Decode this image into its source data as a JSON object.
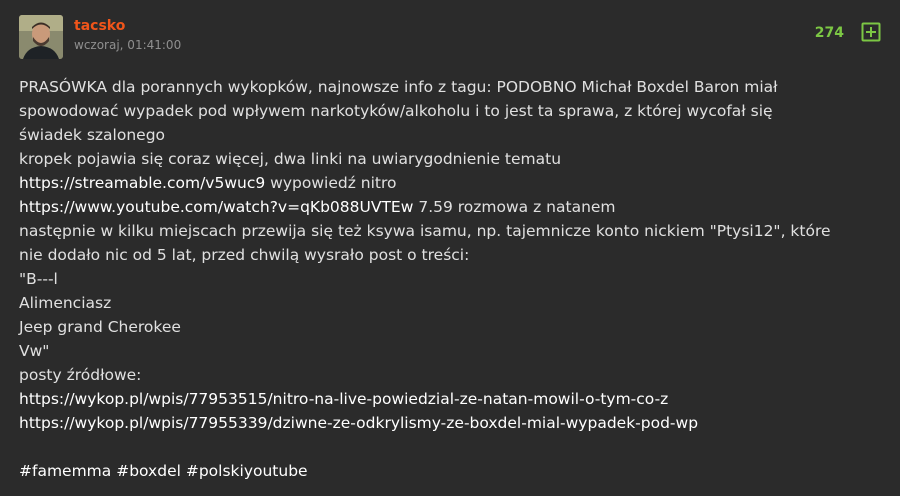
{
  "author": {
    "name": "tacsko",
    "timestamp": "wczoraj, 01:41:00"
  },
  "votes": {
    "count": "274",
    "plus_icon": "plus-square-icon"
  },
  "colors": {
    "background": "#2b2b2b",
    "author": "#f1551a",
    "votes": "#7cc744",
    "text": "#e0e0e0",
    "link": "#ffffff"
  },
  "content": {
    "line1": "PRASÓWKA dla porannych wykopków, najnowsze info z tagu: PODOBNO Michał Boxdel Baron miał",
    "line2": "spowodować wypadek pod wpływem narkotyków/alkoholu i to jest ta sprawa, z której wycofał się",
    "line3": "świadek szalonego",
    "line4": "kropek pojawia się coraz więcej, dwa linki na uwiarygodnienie tematu",
    "link1": "https://streamable.com/v5wuc9",
    "link1_suffix": " wypowiedź nitro",
    "link2": "https://www.youtube.com/watch?v=qKb088UVTEw",
    "link2_suffix": " 7.59 rozmowa z natanem",
    "line7": "następnie w kilku miejscach przewija się też ksywa isamu, np. tajemnicze konto nickiem \"Ptysi12\", które",
    "line8": "nie dodało nic od 5 lat, przed chwilą wysrało post o treści:",
    "quote1": "\"B---l",
    "quote2": "Alimenciasz",
    "quote3": "Jeep grand Cherokee",
    "quote4": "Vw\"",
    "sources_label": "posty źródłowe:",
    "source1": "https://wykop.pl/wpis/77953515/nitro-na-live-powiedzial-ze-natan-mowil-o-tym-co-z",
    "source2": "https://wykop.pl/wpis/77955339/dziwne-ze-odkrylismy-ze-boxdel-mial-wypadek-pod-wp",
    "tags": [
      "#famemma",
      "#boxdel",
      "#polskiyoutube"
    ]
  }
}
